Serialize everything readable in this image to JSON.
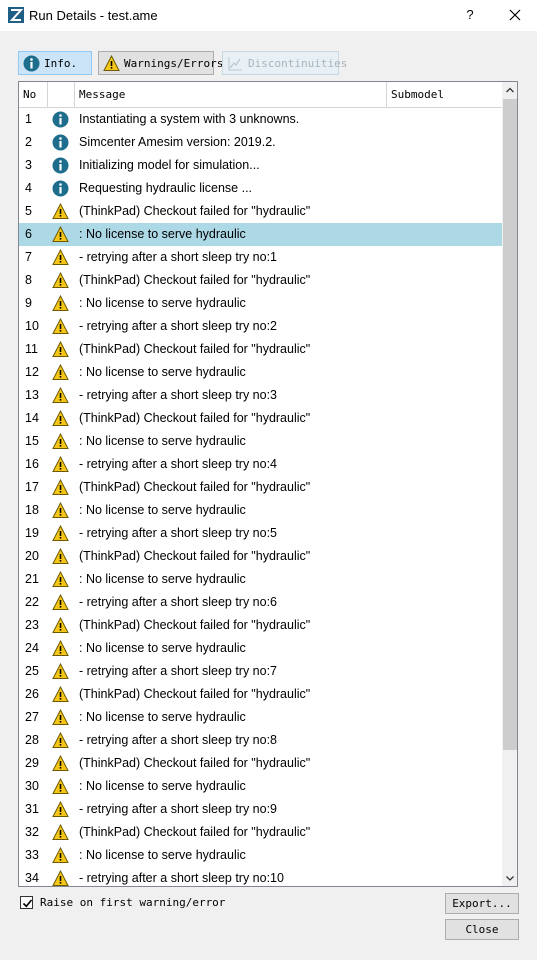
{
  "window": {
    "title": "Run Details - test.ame",
    "help_label": "?"
  },
  "toolbar": {
    "info_label": "Info.",
    "warnings_label": "Warnings/Errors",
    "discontinuities_label": "Discontinuities"
  },
  "table": {
    "columns": [
      "No",
      "",
      "Message",
      "Submodel"
    ],
    "selected_row": 6,
    "rows": [
      {
        "no": "1",
        "type": "info",
        "message": "Instantiating a system with 3 unknowns."
      },
      {
        "no": "2",
        "type": "info",
        "message": "Simcenter Amesim version: 2019.2."
      },
      {
        "no": "3",
        "type": "info",
        "message": "Initializing model for simulation..."
      },
      {
        "no": "4",
        "type": "info",
        "message": "Requesting hydraulic license ..."
      },
      {
        "no": "5",
        "type": "warning",
        "message": "(ThinkPad) Checkout failed for \"hydraulic\""
      },
      {
        "no": "6",
        "type": "warning",
        "message": ": No license to serve hydraulic"
      },
      {
        "no": "7",
        "type": "warning",
        "message": "- retrying after a short sleep try no:1"
      },
      {
        "no": "8",
        "type": "warning",
        "message": "(ThinkPad) Checkout failed for \"hydraulic\""
      },
      {
        "no": "9",
        "type": "warning",
        "message": ": No license to serve hydraulic"
      },
      {
        "no": "10",
        "type": "warning",
        "message": "- retrying after a short sleep try no:2"
      },
      {
        "no": "11",
        "type": "warning",
        "message": "(ThinkPad) Checkout failed for \"hydraulic\""
      },
      {
        "no": "12",
        "type": "warning",
        "message": ": No license to serve hydraulic"
      },
      {
        "no": "13",
        "type": "warning",
        "message": "- retrying after a short sleep try no:3"
      },
      {
        "no": "14",
        "type": "warning",
        "message": "(ThinkPad) Checkout failed for \"hydraulic\""
      },
      {
        "no": "15",
        "type": "warning",
        "message": ": No license to serve hydraulic"
      },
      {
        "no": "16",
        "type": "warning",
        "message": "- retrying after a short sleep try no:4"
      },
      {
        "no": "17",
        "type": "warning",
        "message": "(ThinkPad) Checkout failed for \"hydraulic\""
      },
      {
        "no": "18",
        "type": "warning",
        "message": ": No license to serve hydraulic"
      },
      {
        "no": "19",
        "type": "warning",
        "message": "- retrying after a short sleep try no:5"
      },
      {
        "no": "20",
        "type": "warning",
        "message": "(ThinkPad) Checkout failed for \"hydraulic\""
      },
      {
        "no": "21",
        "type": "warning",
        "message": ": No license to serve hydraulic"
      },
      {
        "no": "22",
        "type": "warning",
        "message": "- retrying after a short sleep try no:6"
      },
      {
        "no": "23",
        "type": "warning",
        "message": "(ThinkPad) Checkout failed for \"hydraulic\""
      },
      {
        "no": "24",
        "type": "warning",
        "message": ": No license to serve hydraulic"
      },
      {
        "no": "25",
        "type": "warning",
        "message": "- retrying after a short sleep try no:7"
      },
      {
        "no": "26",
        "type": "warning",
        "message": "(ThinkPad) Checkout failed for \"hydraulic\""
      },
      {
        "no": "27",
        "type": "warning",
        "message": ": No license to serve hydraulic"
      },
      {
        "no": "28",
        "type": "warning",
        "message": "- retrying after a short sleep try no:8"
      },
      {
        "no": "29",
        "type": "warning",
        "message": "(ThinkPad) Checkout failed for \"hydraulic\""
      },
      {
        "no": "30",
        "type": "warning",
        "message": ": No license to serve hydraulic"
      },
      {
        "no": "31",
        "type": "warning",
        "message": "- retrying after a short sleep try no:9"
      },
      {
        "no": "32",
        "type": "warning",
        "message": "(ThinkPad) Checkout failed for \"hydraulic\""
      },
      {
        "no": "33",
        "type": "warning",
        "message": ": No license to serve hydraulic"
      },
      {
        "no": "34",
        "type": "warning",
        "message": "- retrying after a short sleep try no:10"
      }
    ]
  },
  "footer": {
    "checkbox_label": "Raise on first warning/error",
    "checkbox_checked": true,
    "export_label": "Export...",
    "close_label": "Close"
  },
  "colors": {
    "info_icon": "#1f6d8c",
    "warning_icon": "#f5c518",
    "selected_row": "#add8e6",
    "active_toggle": "#cce4f7"
  }
}
